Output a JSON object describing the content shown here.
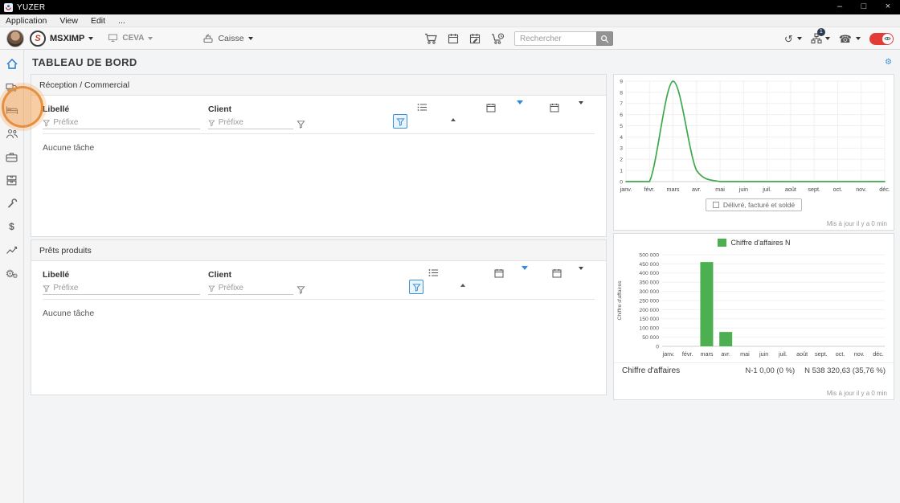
{
  "window": {
    "title": "YUZER",
    "minimize": "–",
    "maximize": "□",
    "close": "×"
  },
  "menubar": {
    "items": [
      "Application",
      "View",
      "Edit",
      "..."
    ]
  },
  "toolbar": {
    "brand_logo_letter": "S",
    "brand_name": "MSXIMP",
    "company_name": "CEVA",
    "register_label": "Caisse",
    "search_placeholder": "Rechercher",
    "apps_badge": "1"
  },
  "page": {
    "title": "TABLEAU DE BORD"
  },
  "panels": [
    {
      "title": "Réception / Commercial",
      "col_libelle": "Libellé",
      "col_client": "Client",
      "filter_placeholder": "Préfixe",
      "empty": "Aucune tâche"
    },
    {
      "title": "Prêts produits",
      "col_libelle": "Libellé",
      "col_client": "Client",
      "filter_placeholder": "Préfixe",
      "empty": "Aucune tâche"
    }
  ],
  "line_card": {
    "updated": "Mis à jour il y a 0 min"
  },
  "bar_card": {
    "footer_label": "Chiffre d'affaires",
    "footer_n1": "N-1 0,00 (0 %)",
    "footer_n": "N 538 320,63 (35,76 %)",
    "updated": "Mis à jour il y a 0 min"
  },
  "icons": {
    "dollar": "$",
    "gear": "⚙",
    "history": "↺",
    "phone": "☎"
  },
  "chart_data": [
    {
      "type": "line",
      "categories": [
        "janv.",
        "févr.",
        "mars",
        "avr.",
        "mai",
        "juin",
        "juil.",
        "août",
        "sept.",
        "oct.",
        "nov.",
        "déc."
      ],
      "series": [
        {
          "name": "Délivré, facturé et soldé",
          "values": [
            0,
            0,
            9,
            1,
            0,
            0,
            0,
            0,
            0,
            0,
            0,
            0
          ],
          "color": "#3fa84c"
        }
      ],
      "title": "",
      "xlabel": "",
      "ylabel": "",
      "ylim": [
        0,
        9
      ],
      "ytick_step": 1,
      "grid": true,
      "legend_position": "bottom"
    },
    {
      "type": "bar",
      "categories": [
        "janv.",
        "févr.",
        "mars",
        "avr.",
        "mai",
        "juin",
        "juil.",
        "août",
        "sept.",
        "oct.",
        "nov.",
        "déc."
      ],
      "series": [
        {
          "name": "Chiffre d'affaires N",
          "values": [
            0,
            0,
            460000,
            78320,
            0,
            0,
            0,
            0,
            0,
            0,
            0,
            0
          ],
          "color": "#4caf50"
        }
      ],
      "title": "",
      "xlabel": "",
      "ylabel": "Chiffre d'affaires",
      "ylim": [
        0,
        500000
      ],
      "ytick_step": 50000,
      "grid": true,
      "legend_position": "top"
    }
  ]
}
